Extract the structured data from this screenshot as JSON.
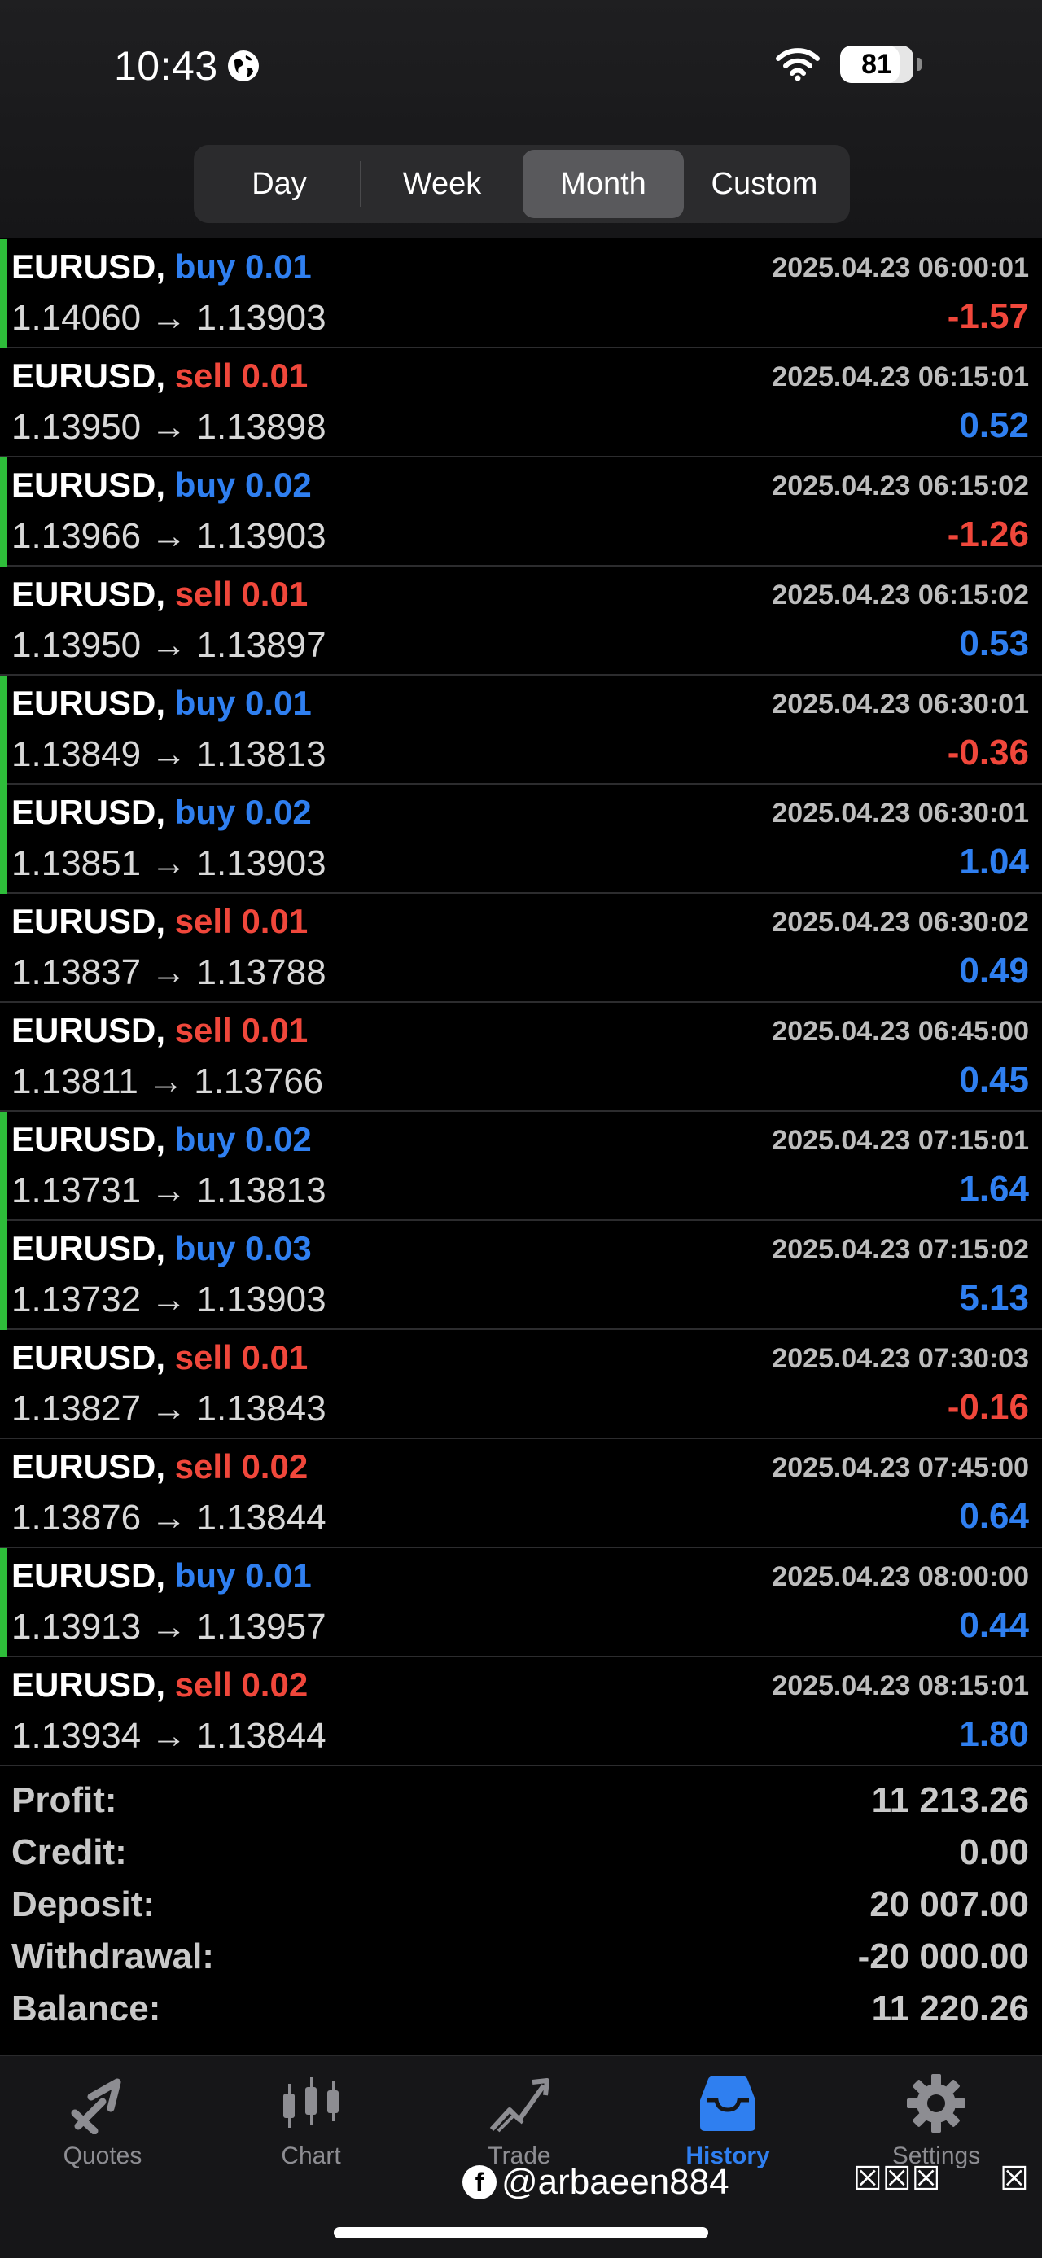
{
  "status_bar": {
    "time": "10:43",
    "battery": "81",
    "battery_level_pct": 81
  },
  "segments": [
    {
      "label": "Day",
      "active": false
    },
    {
      "label": "Week",
      "active": false
    },
    {
      "label": "Month",
      "active": true
    },
    {
      "label": "Custom",
      "active": false
    }
  ],
  "deals": [
    {
      "symbol": "EURUSD,",
      "side": "buy",
      "volume": "0.01",
      "prices": "1.14060 → 1.13903",
      "time": "2025.04.23 06:00:01",
      "profit": "-1.57"
    },
    {
      "symbol": "EURUSD,",
      "side": "sell",
      "volume": "0.01",
      "prices": "1.13950 → 1.13898",
      "time": "2025.04.23 06:15:01",
      "profit": "0.52"
    },
    {
      "symbol": "EURUSD,",
      "side": "buy",
      "volume": "0.02",
      "prices": "1.13966 → 1.13903",
      "time": "2025.04.23 06:15:02",
      "profit": "-1.26"
    },
    {
      "symbol": "EURUSD,",
      "side": "sell",
      "volume": "0.01",
      "prices": "1.13950 → 1.13897",
      "time": "2025.04.23 06:15:02",
      "profit": "0.53"
    },
    {
      "symbol": "EURUSD,",
      "side": "buy",
      "volume": "0.01",
      "prices": "1.13849 → 1.13813",
      "time": "2025.04.23 06:30:01",
      "profit": "-0.36"
    },
    {
      "symbol": "EURUSD,",
      "side": "buy",
      "volume": "0.02",
      "prices": "1.13851 → 1.13903",
      "time": "2025.04.23 06:30:01",
      "profit": "1.04"
    },
    {
      "symbol": "EURUSD,",
      "side": "sell",
      "volume": "0.01",
      "prices": "1.13837 → 1.13788",
      "time": "2025.04.23 06:30:02",
      "profit": "0.49"
    },
    {
      "symbol": "EURUSD,",
      "side": "sell",
      "volume": "0.01",
      "prices": "1.13811 → 1.13766",
      "time": "2025.04.23 06:45:00",
      "profit": "0.45"
    },
    {
      "symbol": "EURUSD,",
      "side": "buy",
      "volume": "0.02",
      "prices": "1.13731 → 1.13813",
      "time": "2025.04.23 07:15:01",
      "profit": "1.64"
    },
    {
      "symbol": "EURUSD,",
      "side": "buy",
      "volume": "0.03",
      "prices": "1.13732 → 1.13903",
      "time": "2025.04.23 07:15:02",
      "profit": "5.13"
    },
    {
      "symbol": "EURUSD,",
      "side": "sell",
      "volume": "0.01",
      "prices": "1.13827 → 1.13843",
      "time": "2025.04.23 07:30:03",
      "profit": "-0.16"
    },
    {
      "symbol": "EURUSD,",
      "side": "sell",
      "volume": "0.02",
      "prices": "1.13876 → 1.13844",
      "time": "2025.04.23 07:45:00",
      "profit": "0.64"
    },
    {
      "symbol": "EURUSD,",
      "side": "buy",
      "volume": "0.01",
      "prices": "1.13913 → 1.13957",
      "time": "2025.04.23 08:00:00",
      "profit": "0.44"
    },
    {
      "symbol": "EURUSD,",
      "side": "sell",
      "volume": "0.02",
      "prices": "1.13934 → 1.13844",
      "time": "2025.04.23 08:15:01",
      "profit": "1.80"
    }
  ],
  "summary": [
    {
      "label": "Profit:",
      "value": "11 213.26"
    },
    {
      "label": "Credit:",
      "value": "0.00"
    },
    {
      "label": "Deposit:",
      "value": "20 007.00"
    },
    {
      "label": "Withdrawal:",
      "value": "-20 000.00"
    },
    {
      "label": "Balance:",
      "value": "11 220.26"
    }
  ],
  "tabs": [
    {
      "label": "Quotes",
      "icon": "quotes-icon",
      "active": false
    },
    {
      "label": "Chart",
      "icon": "chart-icon",
      "active": false
    },
    {
      "label": "Trade",
      "icon": "trade-icon",
      "active": false
    },
    {
      "label": "History",
      "icon": "history-icon",
      "active": true
    },
    {
      "label": "Settings",
      "icon": "gear-icon",
      "active": false
    }
  ],
  "watermark": {
    "fb": "f",
    "handle": "@arbaeen884",
    "boxes_a": "☒☒☒",
    "boxes_b": "☒"
  },
  "colors": {
    "buy": "#2f7ff0",
    "sell": "#f0473b",
    "buy_bar": "#2ebd3a",
    "active_tab": "#2f7ff0"
  }
}
